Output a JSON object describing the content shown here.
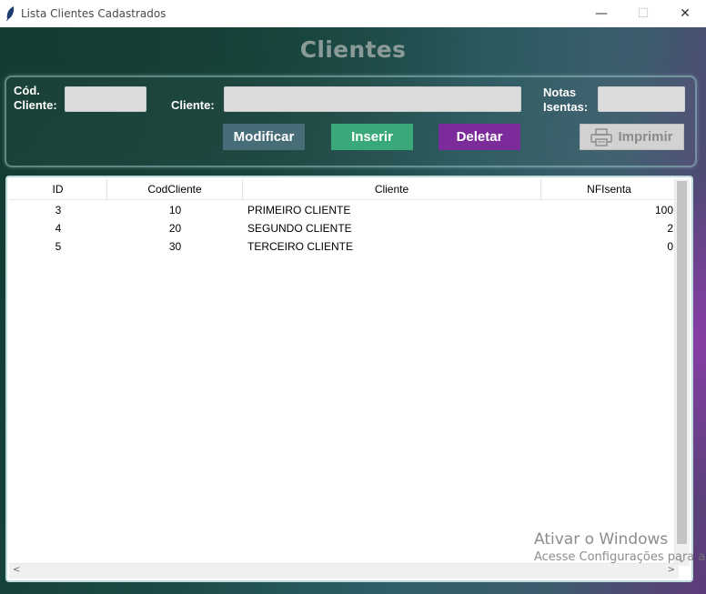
{
  "window": {
    "title": "Lista Clientes Cadastrados",
    "minimize_glyph": "—",
    "maximize_glyph": "☐",
    "close_glyph": "✕"
  },
  "page": {
    "heading": "Clientes"
  },
  "form": {
    "cod_label_line1": "Cód.",
    "cod_label_line2": "Cliente:",
    "cod_value": "",
    "cliente_label": "Cliente:",
    "cliente_value": "",
    "notas_label_line1": "Notas",
    "notas_label_line2": "Isentas:",
    "notas_value": ""
  },
  "buttons": {
    "modificar": "Modificar",
    "inserir": "Inserir",
    "deletar": "Deletar",
    "imprimir": "Imprimir"
  },
  "table": {
    "columns": [
      "ID",
      "CodCliente",
      "Cliente",
      "NFIsenta"
    ],
    "rows": [
      {
        "id": "3",
        "cod": "10",
        "cliente": "PRIMEIRO CLIENTE",
        "nf": "100"
      },
      {
        "id": "4",
        "cod": "20",
        "cliente": "SEGUNDO CLIENTE",
        "nf": "2"
      },
      {
        "id": "5",
        "cod": "30",
        "cliente": "TERCEIRO CLIENTE",
        "nf": "0"
      }
    ]
  },
  "activation": {
    "line1": "Ativar o Windows",
    "line2": "Acesse Configurações para a"
  },
  "colors": {
    "modificar": "#476d79",
    "inserir": "#3aa97a",
    "deletar": "#7c2c9a"
  }
}
